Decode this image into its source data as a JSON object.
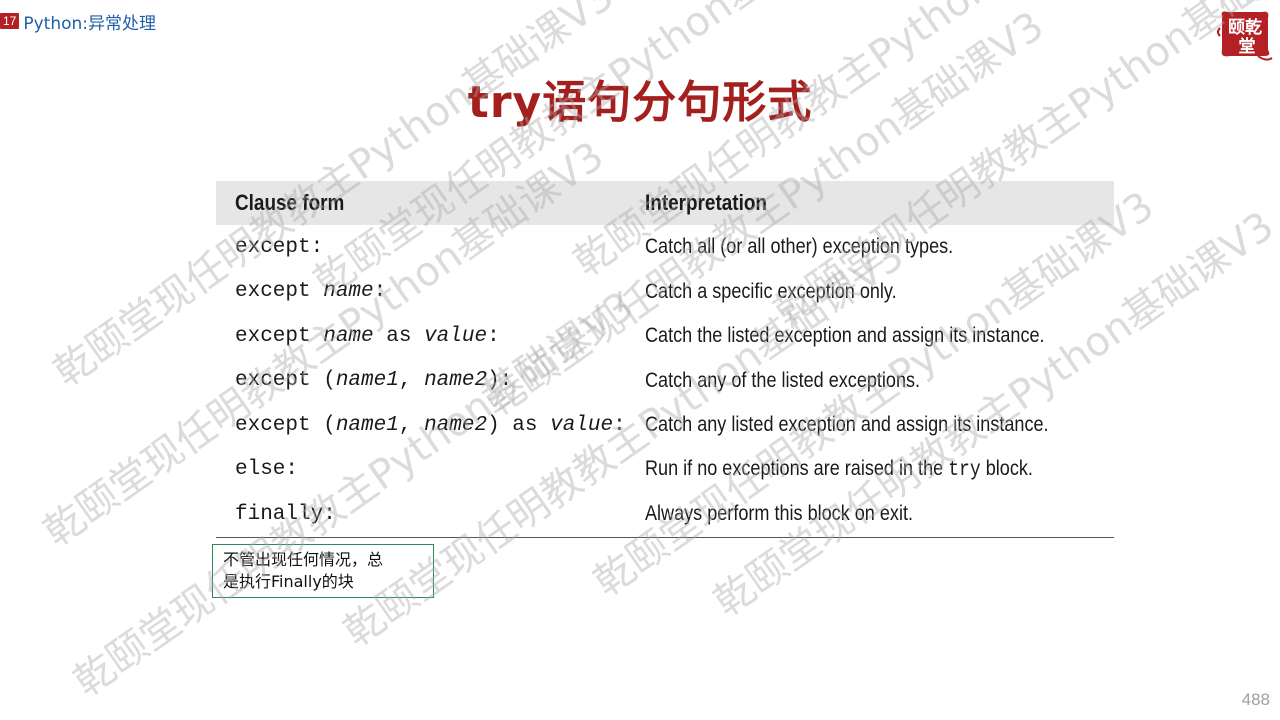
{
  "header": {
    "slide_no": "17",
    "section": "Python:异常处理"
  },
  "logo": {
    "line1": "颐乾",
    "line2": "堂"
  },
  "title": "try语句分句形式",
  "table": {
    "headers": [
      "Clause form",
      "Interpretation"
    ],
    "rows": [
      {
        "form": [
          {
            "t": "except:",
            "i": false
          }
        ],
        "interp": "Catch all (or all other) exception types."
      },
      {
        "form": [
          {
            "t": "except ",
            "i": false
          },
          {
            "t": "name",
            "i": true
          },
          {
            "t": ":",
            "i": false
          }
        ],
        "interp": "Catch a specific exception only."
      },
      {
        "form": [
          {
            "t": "except ",
            "i": false
          },
          {
            "t": "name",
            "i": true
          },
          {
            "t": " as ",
            "i": false
          },
          {
            "t": "value",
            "i": true
          },
          {
            "t": ":",
            "i": false
          }
        ],
        "interp": "Catch the listed exception and assign its instance."
      },
      {
        "form": [
          {
            "t": "except (",
            "i": false
          },
          {
            "t": "name1",
            "i": true
          },
          {
            "t": ", ",
            "i": false
          },
          {
            "t": "name2",
            "i": true
          },
          {
            "t": "):",
            "i": false
          }
        ],
        "interp": "Catch any of the listed exceptions."
      },
      {
        "form": [
          {
            "t": "except (",
            "i": false
          },
          {
            "t": "name1",
            "i": true
          },
          {
            "t": ", ",
            "i": false
          },
          {
            "t": "name2",
            "i": true
          },
          {
            "t": ") as ",
            "i": false
          },
          {
            "t": "value",
            "i": true
          },
          {
            "t": ":",
            "i": false
          }
        ],
        "interp": "Catch any listed exception and assign its instance."
      },
      {
        "form": [
          {
            "t": "else:",
            "i": false
          }
        ],
        "interp_parts": [
          "Run if no exceptions are raised in the ",
          "try",
          " block."
        ]
      },
      {
        "form": [
          {
            "t": "finally:",
            "i": false
          }
        ],
        "interp": "Always perform this block on exit."
      }
    ]
  },
  "note": {
    "line1": "不管出现任何情况，总",
    "line2": "是执行Finally的块"
  },
  "watermark_text": "乾颐堂现任明教教主Python基础课V3",
  "page_number": "488",
  "colors": {
    "title": "#a3201f",
    "badge": "#b32025",
    "section": "#1f5fa8",
    "note_border": "#2e8b57"
  }
}
